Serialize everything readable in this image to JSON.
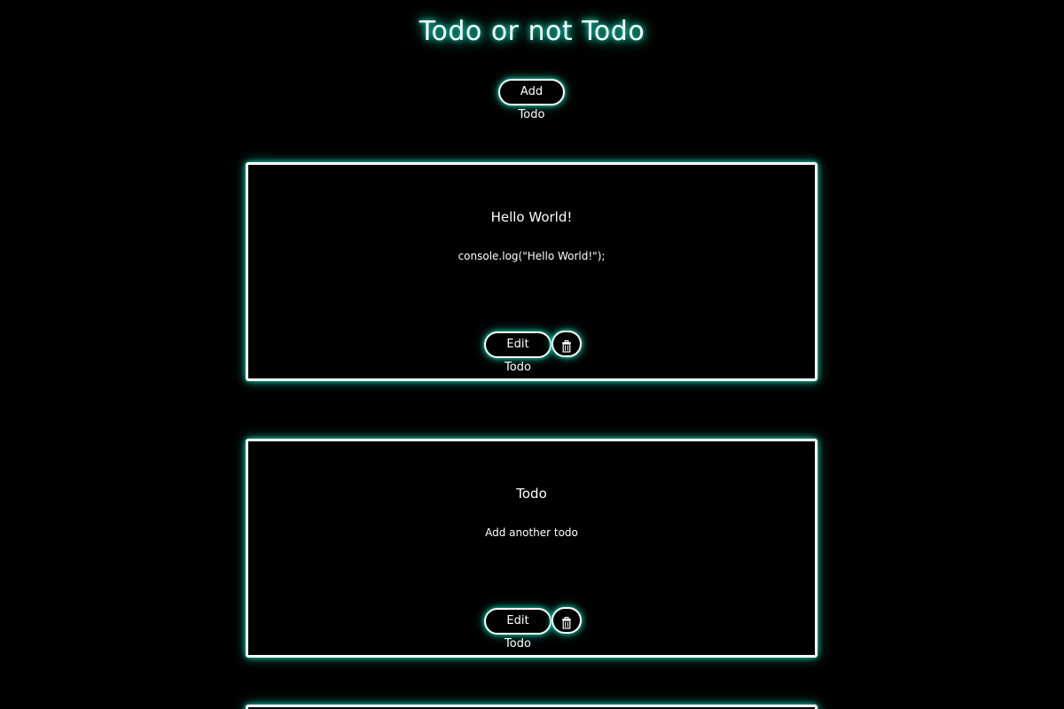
{
  "header": {
    "title": "Todo or not Todo",
    "add_label": "Add Todo"
  },
  "todos": [
    {
      "title": "Hello World!",
      "text": "console.log(\"Hello World!\");",
      "edit_label": "Edit Todo"
    },
    {
      "title": "Todo",
      "text": "Add another todo",
      "edit_label": "Edit Todo"
    }
  ],
  "icons": {
    "delete": "trash-icon"
  },
  "colors": {
    "background": "#000000",
    "glow": "#12d6b4",
    "foreground": "#ffffff"
  }
}
